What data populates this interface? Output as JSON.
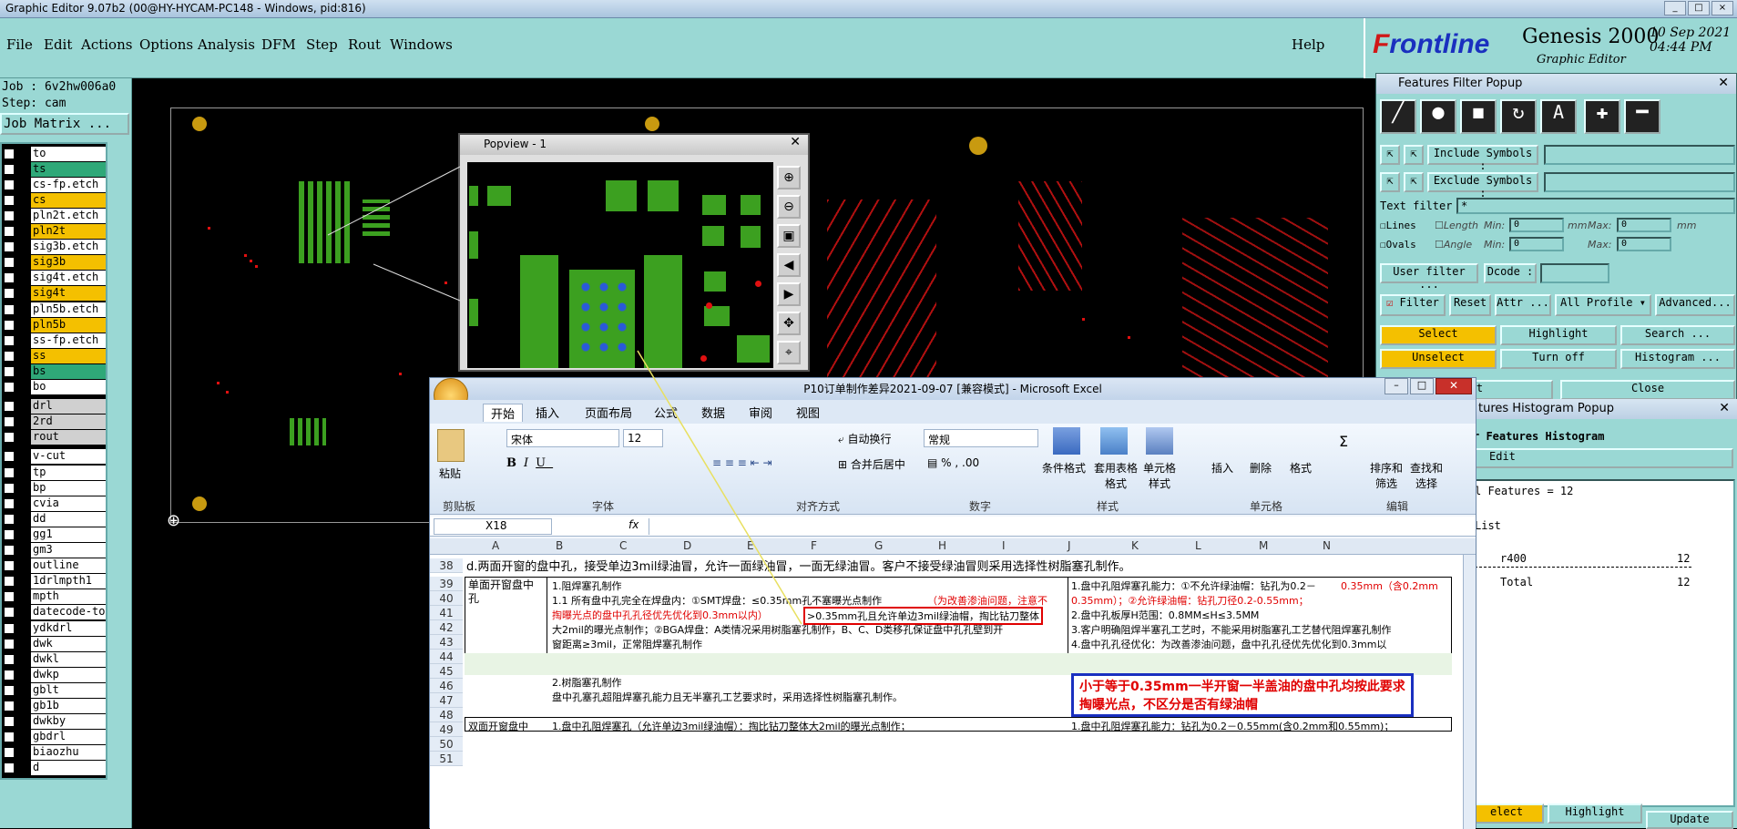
{
  "titlebar": {
    "title": "Graphic Editor 9.07b2 (00@HY-HYCAM-PC148 - Windows, pid:816)"
  },
  "menu": [
    "File",
    "Edit",
    "Actions",
    "Options",
    "Analysis",
    "DFM",
    "Step",
    "Rout",
    "Windows"
  ],
  "help": "Help",
  "brand": {
    "logo_f": "F",
    "logo_rest": "rontline",
    "product": "Genesis 2000",
    "subtitle": "Graphic Editor",
    "date": "10 Sep 2021",
    "time": "04:44 PM"
  },
  "job": {
    "job": "Job : 6v2hw006a0",
    "step": "Step: cam",
    "matrix": "Job Matrix ..."
  },
  "layers": [
    {
      "name": "to",
      "color": "#ffffff"
    },
    {
      "name": "ts",
      "color": "#2fa878"
    },
    {
      "name": "cs-fp.etch",
      "color": "#ffffff"
    },
    {
      "name": "cs",
      "color": "#f4c000"
    },
    {
      "name": "pln2t.etch",
      "color": "#ffffff"
    },
    {
      "name": "pln2t",
      "color": "#f4c000"
    },
    {
      "name": "sig3b.etch",
      "color": "#ffffff"
    },
    {
      "name": "sig3b",
      "color": "#f4c000"
    },
    {
      "name": "sig4t.etch",
      "color": "#ffffff"
    },
    {
      "name": "sig4t",
      "color": "#f4c000"
    },
    {
      "name": "pln5b.etch",
      "color": "#ffffff"
    },
    {
      "name": "pln5b",
      "color": "#f4c000"
    },
    {
      "name": "ss-fp.etch",
      "color": "#ffffff"
    },
    {
      "name": "ss",
      "color": "#f4c000"
    },
    {
      "name": "bs",
      "color": "#2fa878"
    },
    {
      "name": "bo",
      "color": "#ffffff"
    },
    {
      "name": "drl",
      "color": "#d0d0d0"
    },
    {
      "name": "2rd",
      "color": "#d0d0d0"
    },
    {
      "name": "rout",
      "color": "#d0d0d0"
    },
    {
      "name": "v-cut",
      "color": "#ffffff"
    },
    {
      "name": "tp",
      "color": "#ffffff"
    },
    {
      "name": "bp",
      "color": "#ffffff"
    },
    {
      "name": "cvia",
      "color": "#ffffff"
    },
    {
      "name": "dd",
      "color": "#ffffff"
    },
    {
      "name": "gg1",
      "color": "#ffffff"
    },
    {
      "name": "gm3",
      "color": "#ffffff"
    },
    {
      "name": "outline",
      "color": "#ffffff"
    },
    {
      "name": "1drlmpth1",
      "color": "#ffffff"
    },
    {
      "name": "mpth",
      "color": "#ffffff"
    },
    {
      "name": "datecode-to",
      "color": "#ffffff"
    },
    {
      "name": "ydkdrl",
      "color": "#ffffff"
    },
    {
      "name": "dwk",
      "color": "#ffffff"
    },
    {
      "name": "dwkl",
      "color": "#ffffff"
    },
    {
      "name": "dwkp",
      "color": "#ffffff"
    },
    {
      "name": "gblt",
      "color": "#ffffff"
    },
    {
      "name": "gb1b",
      "color": "#ffffff"
    },
    {
      "name": "dwkby",
      "color": "#ffffff"
    },
    {
      "name": "gbdrl",
      "color": "#ffffff"
    },
    {
      "name": "biaozhu",
      "color": "#ffffff"
    },
    {
      "name": "d",
      "color": "#ffffff"
    }
  ],
  "popview": {
    "title": "Popview - 1"
  },
  "filter": {
    "title": "Features Filter Popup",
    "include": "Include Symbols :",
    "exclude": "Exclude Symbols :",
    "text_filter": "Text filter",
    "text_value": "*",
    "lines": "Lines",
    "ovals": "Ovals",
    "length": "Length",
    "angle": "Angle",
    "min": "Min:",
    "max": "Max:",
    "zero": "0",
    "mm": "mm",
    "user_filter": "User filter ...",
    "dcode": "Dcode :",
    "filter": "Filter",
    "reset": "Reset",
    "attr": "Attr ...",
    "profile": "All Profile",
    "advanced": "Advanced...",
    "select": "Select",
    "highlight": "Highlight",
    "search": "Search ...",
    "unselect": "Unselect",
    "turnoff": "Turn off",
    "histogram": "Histogram ...",
    "reset2": "Reset",
    "close": "Close"
  },
  "hist": {
    "title": "tures Histogram Popup",
    "header": "r Features Histogram",
    "edit": "Edit",
    "total_features": "l Features = 12",
    "list": "List",
    "sym": "r400",
    "sym_count": "12",
    "total": "Total",
    "total_count": "12",
    "select": "elect",
    "highlight": "Highlight",
    "update": "Update"
  },
  "excel": {
    "title": "P10订单制作差异2021-09-07  [兼容模式] - Microsoft Excel",
    "tabs": [
      "开始",
      "插入",
      "页面布局",
      "公式",
      "数据",
      "审阅",
      "视图"
    ],
    "font": "宋体",
    "size": "12",
    "wrap": "自动换行",
    "merge": "合并后居中",
    "numfmt": "常规",
    "paste": "粘贴",
    "cond": "条件格式",
    "table": "套用表格格式",
    "cellstyle": "单元格样式",
    "insert": "插入",
    "delete": "删除",
    "format": "格式",
    "sort": "排序和筛选",
    "find": "查找和选择",
    "groups": [
      "剪贴板",
      "字体",
      "对齐方式",
      "数字",
      "样式",
      "单元格",
      "编辑"
    ],
    "cellref": "X18",
    "fx": "fx",
    "cols": [
      "A",
      "B",
      "C",
      "D",
      "E",
      "F",
      "G",
      "H",
      "I",
      "J",
      "K",
      "L",
      "M",
      "N"
    ],
    "rows": [
      "38",
      "39",
      "40",
      "41",
      "42",
      "43",
      "44",
      "45",
      "46",
      "47",
      "48",
      "49",
      "50",
      "51"
    ],
    "r38": "d.两面开窗的盘中孔，接受单边3mil绿油冒，允许一面绿油冒，一面无绿油冒。客户不接受绿油冒则采用选择性树脂塞孔制作。",
    "a39": "单面开窗盘中孔",
    "b39": "1.阻焊塞孔制作",
    "b40": "1.1 所有盘中孔完全在焊盘内：①SMT焊盘：≤0.35mm孔不塞曝光点制作",
    "b40r": "（为改善渗油问题，注意不",
    "b41r": "掏曝光点的盘中孔孔径优先优化到0.3mm以内）",
    "box": ">0.35mm孔且允许单边3mil绿油帽，掏比钻刀整体",
    "b42": "大2mil的曝光点制作；②BGA焊盘：A类情况采用树脂塞孔制作，B、C、D类移孔保证盘中孔孔壁到开",
    "b43": "窗距离≥3mil，正常阻焊塞孔制作",
    "j39": "1.盘中孔阻焊塞孔能力：①不允许绿油帽：钻孔为0.2－",
    "j39r": "0.35mm（含0.2mm",
    "j40": "0.35mm）；②允许绿油帽：钻孔刀径0.2-0.55mm；",
    "j41": "2.盘中孔板厚H范围：0.8MM≤H≤3.5MM",
    "j42": "3.客户明确阻焊半塞孔工艺时，不能采用树脂塞孔工艺替代阻焊塞孔制作",
    "j43": "4.盘中孔孔径优化：为改善渗油问题，盘中孔孔径优先优化到0.3mm以",
    "b45": "2.树脂塞孔制作",
    "b46": "盘中孔塞孔超阻焊塞孔能力且无半塞孔工艺要求时，采用选择性树脂塞孔制作。",
    "note": "小于等于0.35mm一半开窗一半盖油的盘中孔均按此要求掏曝光点，不区分是否有绿油帽",
    "a48": "双面开窗盘中",
    "b48": "1.盘中孔阻焊塞孔（允许单边3mil绿油帽）：掏比钻刀整体大2mil的曝光点制作；",
    "j48": "1.盘中孔阻焊塞孔能力：钻孔为0.2－0.55mm(含0.2mm和0.55mm)；"
  }
}
